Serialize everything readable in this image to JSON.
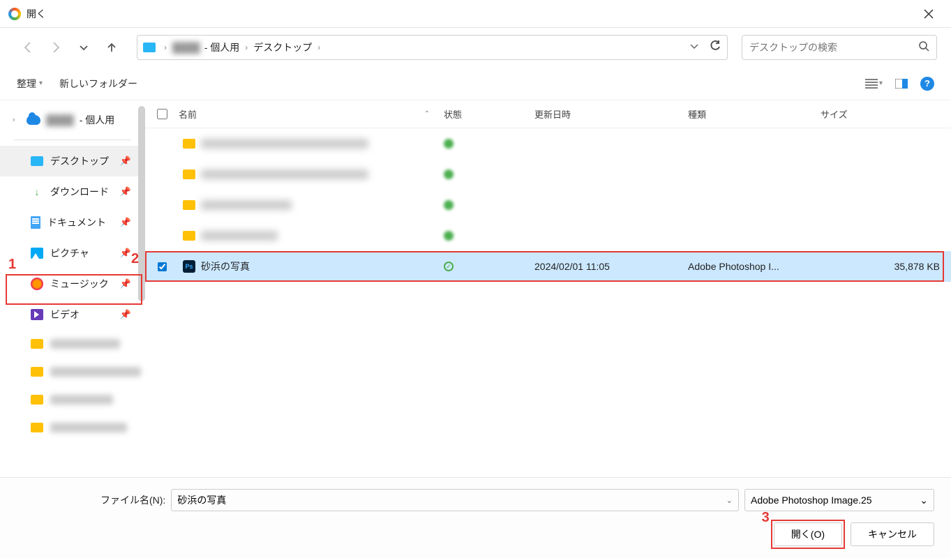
{
  "title": "開く",
  "breadcrumb": {
    "blurred": "████",
    "personal": "- 個人用",
    "desktop": "デスクトップ"
  },
  "search_placeholder": "デスクトップの検索",
  "toolbar": {
    "organize": "整理",
    "newfolder": "新しいフォルダー"
  },
  "tree": {
    "personal": "- 個人用"
  },
  "quick": {
    "desktop": "デスクトップ",
    "downloads": "ダウンロード",
    "documents": "ドキュメント",
    "pictures": "ピクチャ",
    "music": "ミュージック",
    "videos": "ビデオ"
  },
  "columns": {
    "name": "名前",
    "status": "状態",
    "date": "更新日時",
    "type": "種類",
    "size": "サイズ"
  },
  "selected_file": {
    "name": "砂浜の写真",
    "date": "2024/02/01 11:05",
    "type": "Adobe Photoshop I...",
    "size": "35,878 KB"
  },
  "footer": {
    "filename_label": "ファイル名(N):",
    "filename_value": "砂浜の写真",
    "filetype": "Adobe Photoshop Image.25",
    "open": "開く(O)",
    "cancel": "キャンセル"
  },
  "annotations": {
    "a1": "1",
    "a2": "2",
    "a3": "3"
  }
}
